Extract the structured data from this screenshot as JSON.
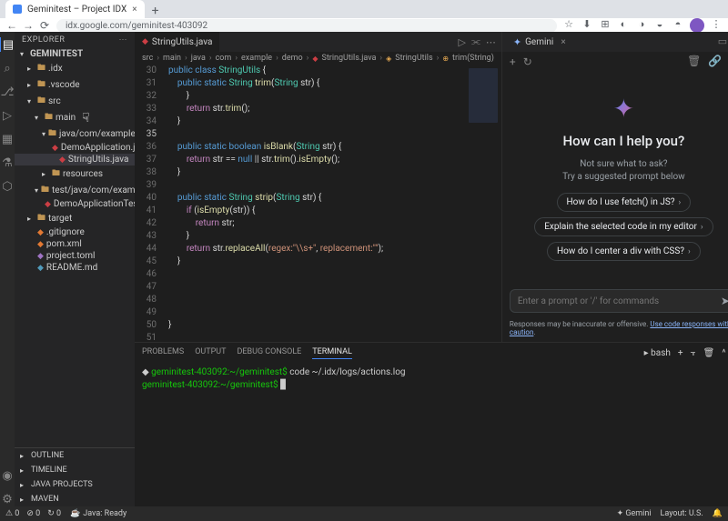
{
  "browser": {
    "tab_title": "Geminitest – Project IDX",
    "url": "idx.google.com/geminitest-403092",
    "new_tab": "+",
    "close": "×"
  },
  "explorer": {
    "title": "EXPLORER",
    "project": "GEMINITEST",
    "tree": [
      {
        "label": ".idx",
        "type": "folder",
        "indent": 1,
        "collapsed": true
      },
      {
        "label": ".vscode",
        "type": "folder",
        "indent": 1,
        "collapsed": true
      },
      {
        "label": "src",
        "type": "folder",
        "indent": 1,
        "collapsed": false
      },
      {
        "label": "main",
        "type": "folder",
        "indent": 2,
        "collapsed": false
      },
      {
        "label": "java/com/example/demo",
        "type": "folder",
        "indent": 3,
        "collapsed": false
      },
      {
        "label": "DemoApplication.java",
        "type": "java",
        "indent": 4
      },
      {
        "label": "StringUtils.java",
        "type": "java",
        "indent": 4,
        "selected": true
      },
      {
        "label": "resources",
        "type": "folder",
        "indent": 3,
        "collapsed": true
      },
      {
        "label": "test/java/com/example/demo",
        "type": "folder",
        "indent": 2,
        "collapsed": false
      },
      {
        "label": "DemoApplicationTests.java",
        "type": "java",
        "indent": 3
      },
      {
        "label": "target",
        "type": "folder",
        "indent": 1,
        "collapsed": true
      },
      {
        "label": ".gitignore",
        "type": "git",
        "indent": 1
      },
      {
        "label": "pom.xml",
        "type": "xml",
        "indent": 1
      },
      {
        "label": "project.toml",
        "type": "toml",
        "indent": 1
      },
      {
        "label": "README.md",
        "type": "md",
        "indent": 1
      }
    ],
    "sections": [
      "OUTLINE",
      "TIMELINE",
      "JAVA PROJECTS",
      "MAVEN"
    ]
  },
  "editor": {
    "tab_name": "StringUtils.java",
    "breadcrumbs": [
      "src",
      "main",
      "java",
      "com",
      "example",
      "demo",
      "StringUtils.java",
      "StringUtils",
      "trim(String)"
    ],
    "line_numbers": [
      "30",
      "31",
      "32",
      "33",
      "34",
      "35",
      "36",
      "37",
      "38",
      "39",
      "40",
      "41",
      "42",
      "43",
      "44",
      "45",
      "46",
      "47",
      "48",
      "49",
      "50",
      "51"
    ],
    "highlight_line": "35"
  },
  "gemini": {
    "tab_label": "Gemini",
    "title": "How can I help you?",
    "sub1": "Not sure what to ask?",
    "sub2": "Try a suggested prompt below",
    "suggestions": [
      "How do I use fetch() in JS?",
      "Explain the selected code in my editor",
      "How do I center a div with CSS?"
    ],
    "placeholder": "Enter a prompt or '/' for commands",
    "disclaimer_prefix": "Responses may be inaccurate or offensive. ",
    "disclaimer_link": "Use code responses with caution",
    "disclaimer_suffix": "."
  },
  "panel": {
    "tabs": [
      "PROBLEMS",
      "OUTPUT",
      "DEBUG CONSOLE",
      "TERMINAL"
    ],
    "active_tab": "TERMINAL",
    "shell_label": "bash",
    "term_line1_prompt": "geminitest-403092:~/geminitest$",
    "term_line1_cmd": " code ~/.idx/logs/actions.log",
    "term_line2_prompt": "geminitest-403092:~/geminitest$",
    "term_line2_cmd": " "
  },
  "status": {
    "left_items": [
      "⚠ 0",
      "⊘ 0",
      "↻ 0"
    ],
    "java_ready": "Java: Ready",
    "right_items": [
      "✦ Gemini",
      "Layout: U.S."
    ]
  }
}
